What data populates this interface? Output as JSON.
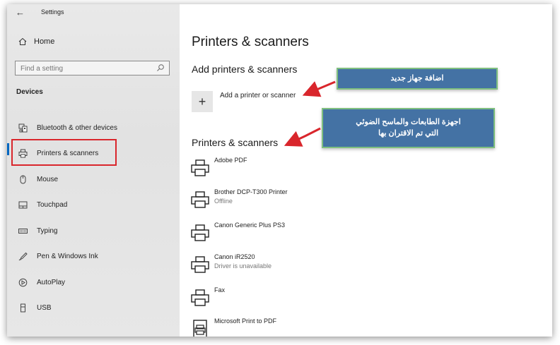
{
  "window": {
    "title": "Settings"
  },
  "sidebar": {
    "home_label": "Home",
    "search_placeholder": "Find a setting",
    "section_label": "Devices",
    "items": [
      {
        "label": "Bluetooth & other devices",
        "icon": "bluetooth-devices-icon"
      },
      {
        "label": "Printers & scanners",
        "icon": "printer-icon",
        "selected": true
      },
      {
        "label": "Mouse",
        "icon": "mouse-icon"
      },
      {
        "label": "Touchpad",
        "icon": "touchpad-icon"
      },
      {
        "label": "Typing",
        "icon": "keyboard-icon"
      },
      {
        "label": "Pen & Windows Ink",
        "icon": "pen-icon"
      },
      {
        "label": "AutoPlay",
        "icon": "autoplay-icon"
      },
      {
        "label": "USB",
        "icon": "usb-icon"
      }
    ]
  },
  "main": {
    "title": "Printers & scanners",
    "add_section_title": "Add printers & scanners",
    "add_label": "Add a printer or scanner",
    "list_title": "Printers & scanners",
    "printers": [
      {
        "name": "Adobe PDF",
        "status": ""
      },
      {
        "name": "Brother DCP-T300 Printer",
        "status": "Offline"
      },
      {
        "name": "Canon Generic Plus PS3",
        "status": ""
      },
      {
        "name": "Canon iR2520",
        "status": "Driver is unavailable"
      },
      {
        "name": "Fax",
        "status": ""
      },
      {
        "name": "Microsoft Print to PDF",
        "status": ""
      }
    ]
  },
  "annotations": {
    "add_device": "اضافة جهاز جديد",
    "paired_line1": "اجهزة الطابعات والماسح الضوئي",
    "paired_line2": "التي تم الاقتران بها"
  },
  "colors": {
    "accent": "#0067c0",
    "highlight_box": "#d9262c",
    "callout_fill": "#4472a4",
    "callout_border": "#7fbf7f",
    "arrow": "#d9262c"
  }
}
